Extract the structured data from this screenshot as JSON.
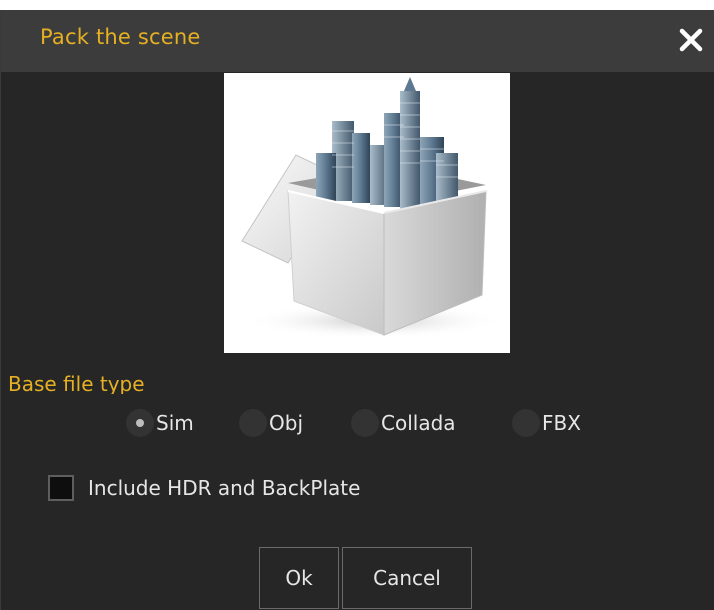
{
  "dialog": {
    "title": "Pack the scene",
    "close_icon": "close-icon",
    "image_description_icon": "packed-scene-box-image"
  },
  "base_file_type": {
    "label": "Base file type",
    "options": [
      {
        "label": "Sim",
        "selected": true
      },
      {
        "label": "Obj",
        "selected": false
      },
      {
        "label": "Collada",
        "selected": false
      },
      {
        "label": "FBX",
        "selected": false
      }
    ]
  },
  "include_hdr": {
    "label": "Include HDR and BackPlate",
    "checked": false
  },
  "buttons": {
    "ok_label": "Ok",
    "cancel_label": "Cancel"
  },
  "colors": {
    "accent": "#e5b022",
    "dialog_bg": "#262626",
    "titlebar_bg": "#3c3c3c",
    "text": "#e6e6e6"
  }
}
